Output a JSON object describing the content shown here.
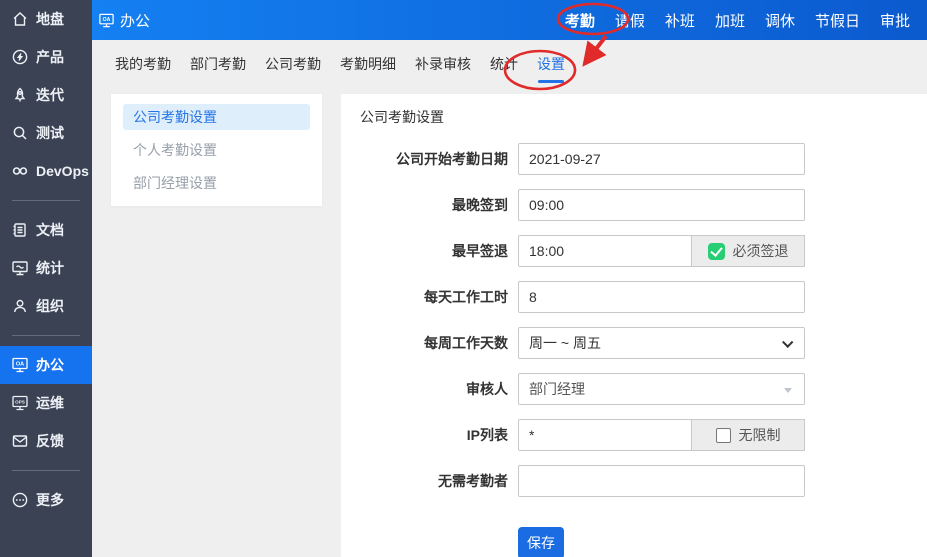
{
  "sidebar": {
    "groups": [
      {
        "items": [
          {
            "icon": "home-icon",
            "label": "地盘"
          },
          {
            "icon": "bulb-icon",
            "label": "产品"
          },
          {
            "icon": "rocket-icon",
            "label": "迭代"
          },
          {
            "icon": "magnifier-icon",
            "label": "测试"
          },
          {
            "icon": "infinity-icon",
            "label": "DevOps"
          }
        ]
      },
      {
        "items": [
          {
            "icon": "document-icon",
            "label": "文档"
          },
          {
            "icon": "monitor-chart-icon",
            "label": "统计"
          },
          {
            "icon": "people-icon",
            "label": "组织"
          }
        ]
      },
      {
        "items": [
          {
            "icon": "monitor-oa-icon",
            "label": "办公",
            "active": true
          },
          {
            "icon": "monitor-ops-icon",
            "label": "运维"
          },
          {
            "icon": "envelope-icon",
            "label": "反馈"
          }
        ]
      },
      {
        "items": [
          {
            "icon": "more-icon",
            "label": "更多"
          }
        ]
      }
    ]
  },
  "topbar": {
    "title": "办公",
    "menu": [
      {
        "label": "考勤",
        "active": true
      },
      {
        "label": "请假"
      },
      {
        "label": "补班"
      },
      {
        "label": "加班"
      },
      {
        "label": "调休"
      },
      {
        "label": "节假日"
      },
      {
        "label": "审批"
      }
    ]
  },
  "tabs": [
    {
      "label": "我的考勤"
    },
    {
      "label": "部门考勤"
    },
    {
      "label": "公司考勤"
    },
    {
      "label": "考勤明细"
    },
    {
      "label": "补录审核"
    },
    {
      "label": "统计"
    },
    {
      "label": "设置",
      "active": true
    }
  ],
  "subnav": {
    "items": [
      {
        "label": "公司考勤设置",
        "active": true
      },
      {
        "label": "个人考勤设置"
      },
      {
        "label": "部门经理设置"
      }
    ]
  },
  "form": {
    "title": "公司考勤设置",
    "fields": [
      {
        "label": "公司开始考勤日期",
        "value": "2021-09-27",
        "type": "input"
      },
      {
        "label": "最晚签到",
        "value": "09:00",
        "type": "input"
      },
      {
        "label": "最早签退",
        "value": "18:00",
        "type": "input-addon",
        "addon_label": "必须签退",
        "addon_checked": true
      },
      {
        "label": "每天工作工时",
        "value": "8",
        "type": "input"
      },
      {
        "label": "每周工作天数",
        "value": "周一 ~ 周五",
        "type": "select"
      },
      {
        "label": "审核人",
        "value": "部门经理",
        "type": "select-disabled"
      },
      {
        "label": "IP列表",
        "value": "*",
        "type": "input-addon",
        "addon_label": "无限制",
        "addon_checked": false
      },
      {
        "label": "无需考勤者",
        "value": "",
        "type": "input"
      }
    ],
    "save_label": "保存"
  },
  "colors": {
    "accent_blue": "#2272e5",
    "sidebar_bg": "#3a4254",
    "active_item_blue": "#1673f0",
    "save_button_blue": "#1b6ce3",
    "checkbox_green": "#27ce74",
    "annotation_red": "#e12a2a",
    "content_bg": "#efefef"
  }
}
